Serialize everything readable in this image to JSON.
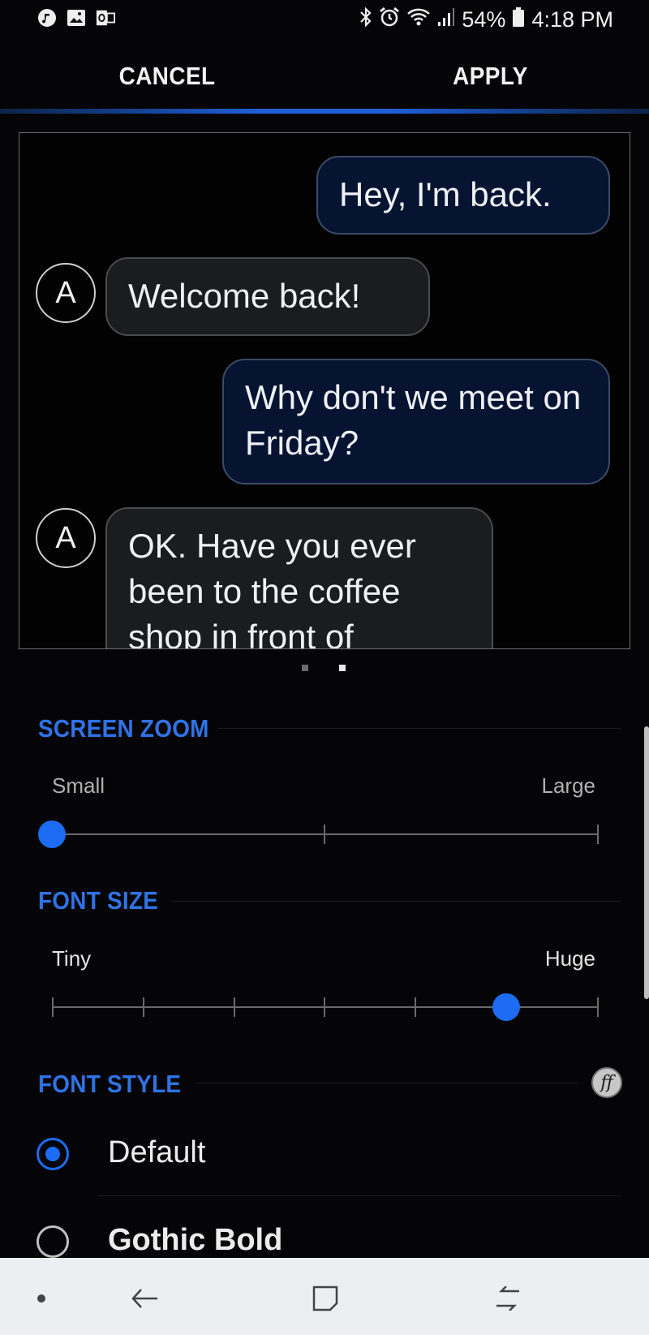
{
  "status_bar": {
    "left_icons": [
      "music-note-icon",
      "gallery-icon",
      "outlook-icon"
    ],
    "right_icons": [
      "bluetooth-icon",
      "alarm-icon",
      "wifi-icon",
      "signal-icon",
      "battery-icon"
    ],
    "battery": "54%",
    "time": "4:18 PM"
  },
  "actions": {
    "cancel_label": "CANCEL",
    "apply_label": "APPLY"
  },
  "preview": {
    "messages": [
      {
        "side": "out",
        "text": "Hey, I'm back."
      },
      {
        "side": "in",
        "avatar": "A",
        "text": "Welcome back!"
      },
      {
        "side": "out",
        "text": "Why don't we meet on Friday?"
      },
      {
        "side": "in",
        "avatar": "A",
        "text": "OK. Have you ever been to the coffee shop in front of"
      }
    ],
    "pages": 2,
    "active_page": 2
  },
  "screen_zoom": {
    "title": "SCREEN ZOOM",
    "min_label": "Small",
    "max_label": "Large",
    "steps": 3,
    "value_index": 0
  },
  "font_size": {
    "title": "FONT SIZE",
    "min_label": "Tiny",
    "max_label": "Huge",
    "steps": 7,
    "value_index": 5
  },
  "font_style": {
    "title": "FONT STYLE",
    "icon": "font-download-icon",
    "options": [
      {
        "label": "Default",
        "selected": true
      },
      {
        "label": "Gothic Bold",
        "selected": false
      }
    ]
  },
  "nav_bar": {
    "items": [
      "dot-icon",
      "back-icon",
      "home-icon",
      "recents-icon"
    ]
  },
  "colors": {
    "accent": "#1c6cf5",
    "section_title": "#2f73e6",
    "outgoing_bubble": "#061432",
    "incoming_bubble": "#1b1c1e"
  }
}
